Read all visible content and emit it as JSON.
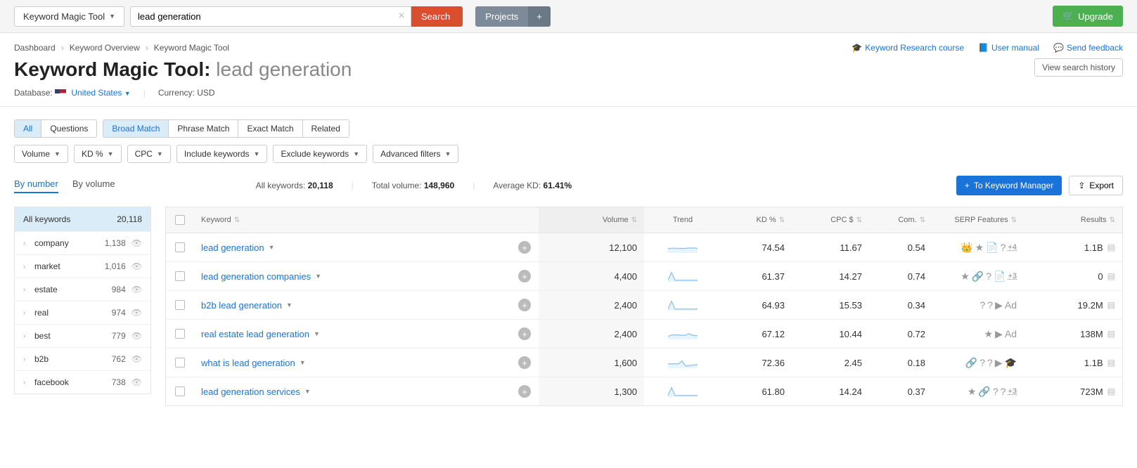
{
  "topbar": {
    "tool_dropdown": "Keyword Magic Tool",
    "search_value": "lead generation",
    "search_button": "Search",
    "projects_button": "Projects",
    "upgrade_button": "Upgrade"
  },
  "breadcrumbs": [
    "Dashboard",
    "Keyword Overview",
    "Keyword Magic Tool"
  ],
  "help_links": {
    "course": "Keyword Research course",
    "manual": "User manual",
    "feedback": "Send feedback"
  },
  "title": {
    "main": "Keyword Magic Tool:",
    "sub": "lead generation"
  },
  "view_history": "View search history",
  "meta": {
    "database_label": "Database:",
    "database_value": "United States",
    "currency_label": "Currency:",
    "currency_value": "USD"
  },
  "tabs1": {
    "all": "All",
    "questions": "Questions"
  },
  "tabs2": {
    "broad": "Broad Match",
    "phrase": "Phrase Match",
    "exact": "Exact Match",
    "related": "Related"
  },
  "filters": {
    "volume": "Volume",
    "kd": "KD %",
    "cpc": "CPC",
    "include": "Include keywords",
    "exclude": "Exclude keywords",
    "advanced": "Advanced filters"
  },
  "sidebar_tabs": {
    "number": "By number",
    "volume": "By volume"
  },
  "summary": {
    "all_keywords_label": "All keywords:",
    "all_keywords_value": "20,118",
    "total_volume_label": "Total volume:",
    "total_volume_value": "148,960",
    "avg_kd_label": "Average KD:",
    "avg_kd_value": "61.41%"
  },
  "actions": {
    "to_manager": "To Keyword Manager",
    "export": "Export"
  },
  "sidebar": {
    "header_label": "All keywords",
    "header_count": "20,118",
    "rows": [
      {
        "name": "company",
        "count": "1,138"
      },
      {
        "name": "market",
        "count": "1,016"
      },
      {
        "name": "estate",
        "count": "984"
      },
      {
        "name": "real",
        "count": "974"
      },
      {
        "name": "best",
        "count": "779"
      },
      {
        "name": "b2b",
        "count": "762"
      },
      {
        "name": "facebook",
        "count": "738"
      }
    ]
  },
  "table": {
    "headers": {
      "keyword": "Keyword",
      "volume": "Volume",
      "trend": "Trend",
      "kd": "KD %",
      "cpc": "CPC $",
      "com": "Com.",
      "serp": "SERP Features",
      "results": "Results"
    },
    "rows": [
      {
        "keyword": "lead generation",
        "volume": "12,100",
        "kd": "74.54",
        "cpc": "11.67",
        "com": "0.54",
        "serp_more": "+4",
        "results": "1.1B",
        "trend": "flat"
      },
      {
        "keyword": "lead generation companies",
        "volume": "4,400",
        "kd": "61.37",
        "cpc": "14.27",
        "com": "0.74",
        "serp_more": "+3",
        "results": "0",
        "trend": "spike"
      },
      {
        "keyword": "b2b lead generation",
        "volume": "2,400",
        "kd": "64.93",
        "cpc": "15.53",
        "com": "0.34",
        "serp_more": "",
        "results": "19.2M",
        "trend": "spike"
      },
      {
        "keyword": "real estate lead generation",
        "volume": "2,400",
        "kd": "67.12",
        "cpc": "10.44",
        "com": "0.72",
        "serp_more": "",
        "results": "138M",
        "trend": "wave"
      },
      {
        "keyword": "what is lead generation",
        "volume": "1,600",
        "kd": "72.36",
        "cpc": "2.45",
        "com": "0.18",
        "serp_more": "",
        "results": "1.1B",
        "trend": "flat2"
      },
      {
        "keyword": "lead generation services",
        "volume": "1,300",
        "kd": "61.80",
        "cpc": "14.24",
        "com": "0.37",
        "serp_more": "+3",
        "results": "723M",
        "trend": "spike"
      }
    ]
  }
}
